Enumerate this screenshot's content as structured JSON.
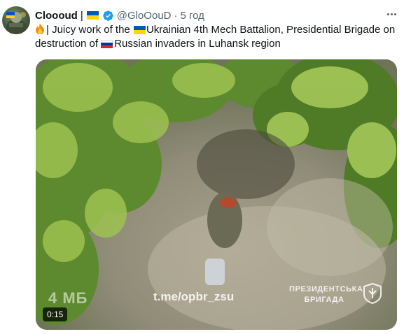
{
  "tweet": {
    "author_name": "Cloooud",
    "name_separator": "|",
    "handle": "@GloOouD",
    "dot": "·",
    "time": "5 год",
    "more_icon": "more-horizontal-icon",
    "text": {
      "part1": "| Juicy work of the ",
      "part2": "Ukrainian 4th Mech Battalion, Presidential Brigade on destruction of ",
      "part3": "Russian invaders in Luhansk region"
    }
  },
  "media": {
    "overlay_size": "4 МБ",
    "overlay_url": "t.me/opbr_zsu",
    "overlay_brand_line1": "ПРЕЗИДЕНТСЬКА",
    "overlay_brand_line2": "БРИГАДА",
    "duration": "0:15"
  },
  "colors": {
    "text": "#0f1419",
    "secondary": "#536471",
    "verified": "#1d9bf0",
    "ua_blue": "#0057b7",
    "ua_yellow": "#ffd700"
  }
}
